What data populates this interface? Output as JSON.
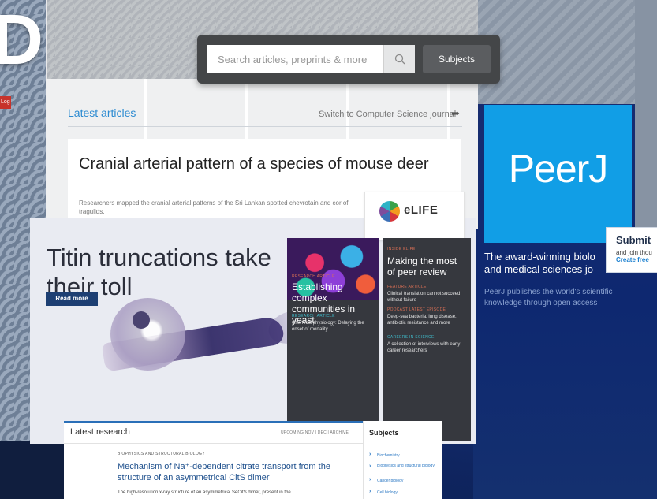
{
  "background": {
    "partial_logo_letter": "D",
    "partial_red_button_text": "Log"
  },
  "midsite": {
    "search_placeholder": "Search articles, preprints & more",
    "search_icon": "search-icon",
    "subjects_button": "Subjects",
    "latest_articles": "Latest articles",
    "switch_journal": "Switch to Computer Science journal",
    "article_title": "Cranial arterial pattern of a species of mouse deer",
    "article_summary": "Researchers mapped the cranial arterial patterns of the Sri Lankan spotted chevrotain and cor of tragulids."
  },
  "peerj": {
    "logo": "PeerJ",
    "tagline": "The award-winning biolo and medical sciences jo",
    "subtext": "PeerJ publishes the world's scientific knowledge through open access",
    "submit_title": "Submit",
    "submit_sub": "and join thou",
    "submit_link": "Create free"
  },
  "elife": {
    "logo_text": "eLIFE",
    "hero_title": "Titin truncations take their toll",
    "read_more": "Read more",
    "col1": {
      "kicker1": "RESEARCH ARTICLE",
      "headline": "Establishing complex communities in yeast",
      "kicker2": "RESEARCH ARTICLE",
      "item1": "Chemical physiology: Delaying the onset of mortality"
    },
    "col2": {
      "kicker1": "INSIDE ELIFE",
      "headline": "Making the most of peer review",
      "kicker2": "FEATURE ARTICLE",
      "item1": "Clinical translation cannot succeed without failure",
      "kicker3": "PODCAST LATEST EPISODE",
      "item2": "Deep-sea bacteria, lung disease, antibiotic resistance and more",
      "kicker4": "CAREERS IN SCIENCE",
      "item3": "A collection of interviews with early-career researchers"
    },
    "research": {
      "title": "Latest research",
      "nav": "UPCOMING      NOV   |   DEC   |   ARCHIVE",
      "kicker": "BIOPHYSICS AND STRUCTURAL BIOLOGY",
      "article_title": "Mechanism of Na⁺-dependent citrate transport from the structure of an asymmetrical CitS dimer",
      "summary": "The high-resolution x-ray structure of an asymmetrical SeCitS dimer, present in the"
    },
    "subjects": {
      "title": "Subjects",
      "items": [
        "Biochemistry",
        "Biophysics and structural biology",
        "Cancer biology",
        "Cell biology"
      ]
    }
  }
}
